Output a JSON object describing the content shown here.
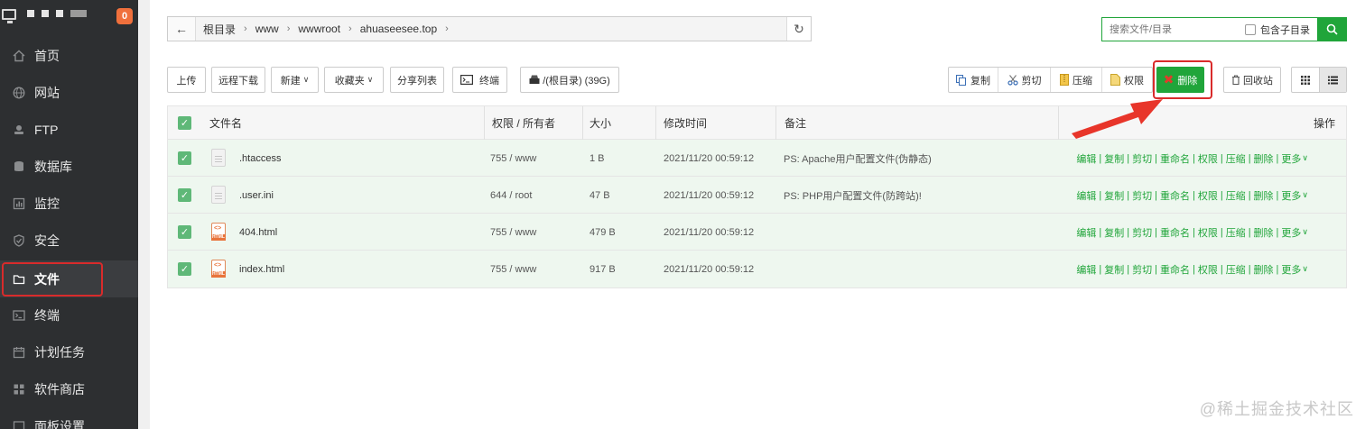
{
  "sidebar": {
    "badge": "0",
    "items": [
      {
        "label": "首页",
        "icon": "home-icon"
      },
      {
        "label": "网站",
        "icon": "globe-icon"
      },
      {
        "label": "FTP",
        "icon": "ftp-icon"
      },
      {
        "label": "数据库",
        "icon": "database-icon"
      },
      {
        "label": "监控",
        "icon": "monitor-icon"
      },
      {
        "label": "安全",
        "icon": "shield-icon"
      },
      {
        "label": "文件",
        "icon": "folder-icon",
        "active": true
      },
      {
        "label": "终端",
        "icon": "terminal-icon"
      },
      {
        "label": "计划任务",
        "icon": "clock-icon"
      },
      {
        "label": "软件商店",
        "icon": "grid-icon"
      },
      {
        "label": "面板设置",
        "icon": "settings-icon"
      }
    ]
  },
  "path": {
    "crumbs": [
      "根目录",
      "www",
      "wwwroot",
      "ahuaseesee.top"
    ]
  },
  "search": {
    "placeholder": "搜索文件/目录",
    "subdir_label": "包含子目录"
  },
  "toolbar": {
    "upload": "上传",
    "remote_download": "远程下载",
    "new": "新建",
    "favorites": "收藏夹",
    "share_list": "分享列表",
    "terminal": "终端",
    "disk": "/(根目录) (39G)",
    "copy": "复制",
    "cut": "剪切",
    "compress": "压缩",
    "permission": "权限",
    "delete": "删除",
    "recycle": "回收站"
  },
  "table": {
    "headers": {
      "name": "文件名",
      "perm": "权限 / 所有者",
      "size": "大小",
      "mtime": "修改时间",
      "note": "备注",
      "ops": "操作"
    },
    "rows": [
      {
        "name": ".htaccess",
        "perm": "755 / www",
        "size": "1 B",
        "mtime": "2021/11/20 00:59:12",
        "note": "PS: Apache用户配置文件(伪静态)",
        "type": "txt"
      },
      {
        "name": ".user.ini",
        "perm": "644 / root",
        "size": "47 B",
        "mtime": "2021/11/20 00:59:12",
        "note": "PS: PHP用户配置文件(防跨站)!",
        "type": "txt"
      },
      {
        "name": "404.html",
        "perm": "755 / www",
        "size": "479 B",
        "mtime": "2021/11/20 00:59:12",
        "note": "",
        "type": "html"
      },
      {
        "name": "index.html",
        "perm": "755 / www",
        "size": "917 B",
        "mtime": "2021/11/20 00:59:12",
        "note": "",
        "type": "html"
      }
    ],
    "ops": [
      "编辑",
      "复制",
      "剪切",
      "重命名",
      "权限",
      "压缩",
      "删除",
      "更多"
    ]
  },
  "html_icon_label": "HTML",
  "watermark": "@稀土掘金技术社区",
  "colors": {
    "accent": "#20a53a",
    "highlight": "#d92b2b",
    "sidebar": "#2d2f31"
  }
}
